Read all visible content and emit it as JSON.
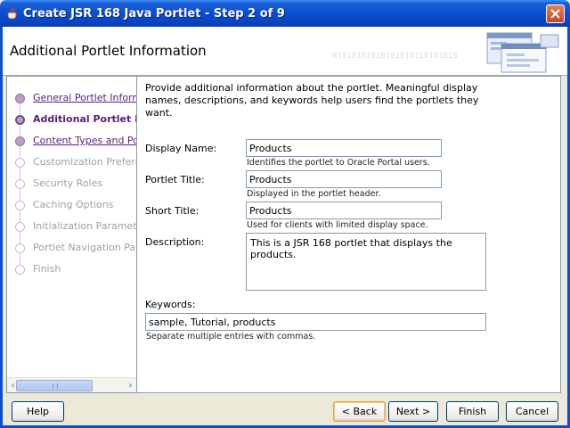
{
  "window": {
    "title": "Create JSR 168 Java Portlet - Step 2 of 9"
  },
  "header": {
    "heading": "Additional Portlet Information",
    "decor_binary": "01010101010101010110101010"
  },
  "steps": [
    {
      "label": "General Portlet Information",
      "state": "link"
    },
    {
      "label": "Additional Portlet Information",
      "state": "current"
    },
    {
      "label": "Content Types and Portlet Modes",
      "state": "link"
    },
    {
      "label": "Customization Preferences",
      "state": "disabled"
    },
    {
      "label": "Security Roles",
      "state": "disabled"
    },
    {
      "label": "Caching Options",
      "state": "disabled"
    },
    {
      "label": "Initialization Parameters",
      "state": "disabled"
    },
    {
      "label": "Portlet Navigation Parameters",
      "state": "disabled"
    },
    {
      "label": "Finish",
      "state": "disabled"
    }
  ],
  "content": {
    "intro": "Provide additional information about the portlet. Meaningful display names, descriptions, and keywords help users find the portlets they want.",
    "display_name": {
      "label": "Display Name:",
      "value": "Products",
      "hint": "Identifies the portlet to Oracle Portal users."
    },
    "portlet_title": {
      "label": "Portlet Title:",
      "value": "Products",
      "hint": "Displayed in the portlet header."
    },
    "short_title": {
      "label": "Short Title:",
      "value": "Products",
      "hint": "Used for clients with limited display space."
    },
    "description": {
      "label": "Description:",
      "value": "This is a JSR 168 portlet that displays the products."
    },
    "keywords": {
      "label": "Keywords:",
      "value": "sample, Tutorial, products",
      "hint": "Separate multiple entries with commas."
    }
  },
  "buttons": {
    "help": "Help",
    "back": "< Back",
    "next": "Next >",
    "finish": "Finish",
    "cancel": "Cancel"
  }
}
